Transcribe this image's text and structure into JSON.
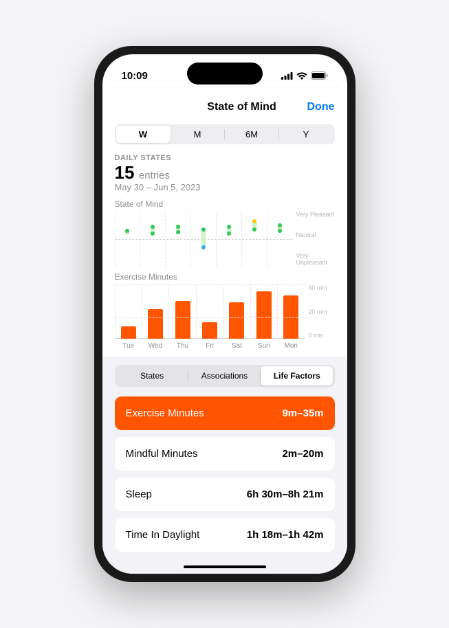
{
  "status": {
    "time": "10:09"
  },
  "nav": {
    "title": "State of Mind",
    "done": "Done"
  },
  "period_segments": [
    {
      "label": "W",
      "active": true
    },
    {
      "label": "M",
      "active": false
    },
    {
      "label": "6M",
      "active": false
    },
    {
      "label": "Y",
      "active": false
    }
  ],
  "summary": {
    "label": "DAILY STATES",
    "count": "15",
    "unit": "entries",
    "range": "May 30 – Jun 5, 2023"
  },
  "mind_chart": {
    "title": "State of Mind",
    "y_labels": {
      "top": "Very Pleasant",
      "mid": "Neutral",
      "bot": "Very Unpleasant"
    }
  },
  "exercise_chart": {
    "title": "Exercise Minutes",
    "y_labels": {
      "top": "40 min",
      "mid": "20 min",
      "bot": "0 min"
    }
  },
  "chart_data": [
    {
      "type": "range-dot",
      "name": "State of Mind",
      "y_scale": [
        -1,
        1
      ],
      "categories": [
        "Tue",
        "Wed",
        "Thu",
        "Fri",
        "Sat",
        "Sun",
        "Mon"
      ],
      "series": [
        {
          "day": "Tue",
          "range": [
            0.15,
            0.35
          ],
          "points": [
            {
              "v": 0.3,
              "c": "#34c759"
            }
          ]
        },
        {
          "day": "Wed",
          "range": [
            0.15,
            0.5
          ],
          "points": [
            {
              "v": 0.45,
              "c": "#34c759"
            },
            {
              "v": 0.2,
              "c": "#34c759"
            }
          ]
        },
        {
          "day": "Thu",
          "range": [
            0.2,
            0.5
          ],
          "points": [
            {
              "v": 0.45,
              "c": "#34c759"
            },
            {
              "v": 0.25,
              "c": "#34c759"
            }
          ]
        },
        {
          "day": "Fri",
          "range": [
            -0.35,
            0.4
          ],
          "points": [
            {
              "v": 0.35,
              "c": "#34c759"
            },
            {
              "v": -0.3,
              "c": "#32ade6"
            }
          ]
        },
        {
          "day": "Sat",
          "range": [
            0.15,
            0.5
          ],
          "points": [
            {
              "v": 0.45,
              "c": "#34c759"
            },
            {
              "v": 0.2,
              "c": "#34c759"
            }
          ]
        },
        {
          "day": "Sun",
          "range": [
            0.3,
            0.7
          ],
          "points": [
            {
              "v": 0.65,
              "c": "#ffcc00"
            },
            {
              "v": 0.35,
              "c": "#34c759"
            }
          ]
        },
        {
          "day": "Mon",
          "range": [
            0.25,
            0.55
          ],
          "points": [
            {
              "v": 0.5,
              "c": "#34c759"
            },
            {
              "v": 0.3,
              "c": "#34c759"
            }
          ]
        }
      ]
    },
    {
      "type": "bar",
      "name": "Exercise Minutes",
      "ylim": [
        0,
        40
      ],
      "ylabel": "min",
      "categories": [
        "Tue",
        "Wed",
        "Thu",
        "Fri",
        "Sat",
        "Sun",
        "Mon"
      ],
      "values": [
        9,
        22,
        28,
        12,
        27,
        35,
        32
      ]
    }
  ],
  "bottom_tabs": [
    {
      "label": "States",
      "active": false
    },
    {
      "label": "Associations",
      "active": false
    },
    {
      "label": "Life Factors",
      "active": true
    }
  ],
  "factors": [
    {
      "name": "Exercise Minutes",
      "value": "9m–35m",
      "primary": true
    },
    {
      "name": "Mindful Minutes",
      "value": "2m–20m",
      "primary": false
    },
    {
      "name": "Sleep",
      "value": "6h 30m–8h 21m",
      "primary": false
    },
    {
      "name": "Time In Daylight",
      "value": "1h 18m–1h 42m",
      "primary": false
    }
  ]
}
